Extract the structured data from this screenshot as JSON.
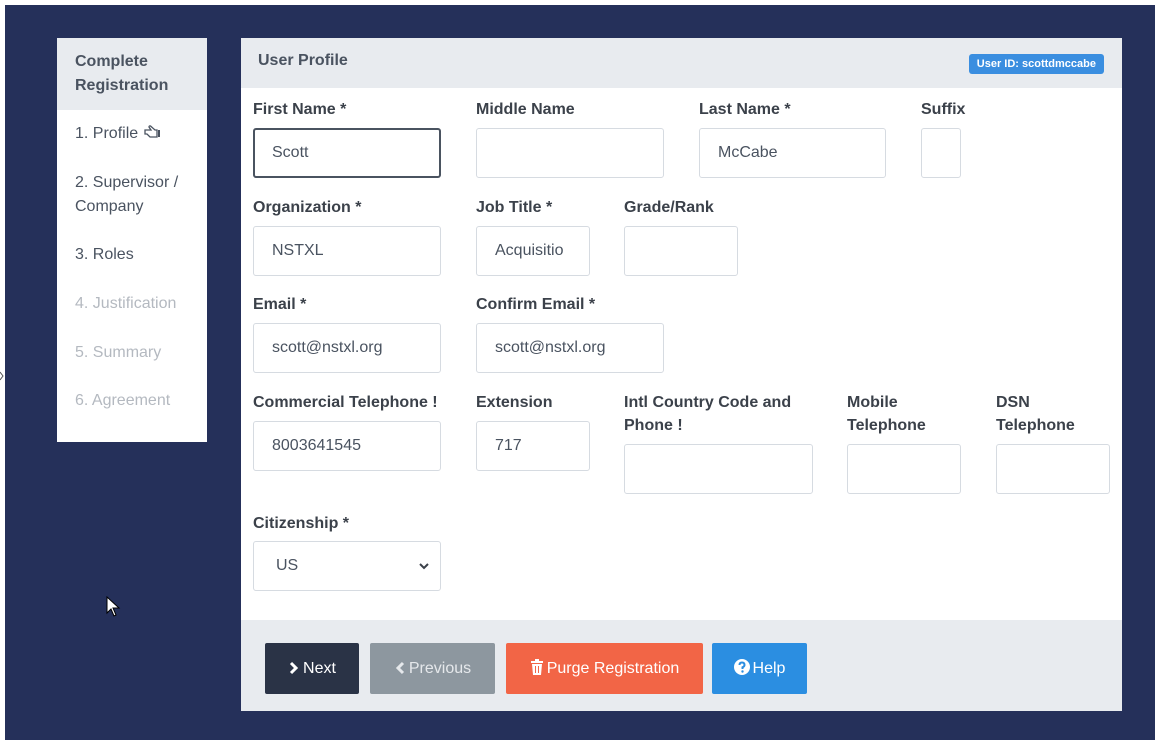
{
  "sidebar": {
    "title": "Complete Registration",
    "steps": [
      {
        "label": "1. Profile",
        "state": "active"
      },
      {
        "label": "2. Supervisor / Company",
        "state": "enabled"
      },
      {
        "label": "3. Roles",
        "state": "enabled"
      },
      {
        "label": "4. Justification",
        "state": "disabled"
      },
      {
        "label": "5. Summary",
        "state": "disabled"
      },
      {
        "label": "6. Agreement",
        "state": "disabled"
      }
    ]
  },
  "panel": {
    "title": "User Profile",
    "user_badge": "User ID: scottdmccabe"
  },
  "fields": {
    "first_name": {
      "label": "First Name *",
      "value": "Scott"
    },
    "middle_name": {
      "label": "Middle Name",
      "value": ""
    },
    "last_name": {
      "label": "Last Name *",
      "value": "McCabe"
    },
    "suffix": {
      "label": "Suffix",
      "value": ""
    },
    "organization": {
      "label": "Organization *",
      "value": "NSTXL"
    },
    "job_title": {
      "label": "Job Title *",
      "value": "Acquisitio"
    },
    "grade_rank": {
      "label": "Grade/Rank",
      "value": ""
    },
    "email": {
      "label": "Email *",
      "value": "scott@nstxl.org"
    },
    "confirm_email": {
      "label": "Confirm Email *",
      "value": "scott@nstxl.org"
    },
    "commercial_telephone": {
      "label": "Commercial Telephone !",
      "value": "8003641545"
    },
    "extension": {
      "label": "Extension",
      "value": "717"
    },
    "intl_phone": {
      "label": "Intl Country Code and Phone !",
      "value": ""
    },
    "mobile_telephone": {
      "label": "Mobile Telephone",
      "value": ""
    },
    "dsn_telephone": {
      "label": "DSN Telephone",
      "value": ""
    },
    "citizenship": {
      "label": "Citizenship *",
      "selected": "US"
    }
  },
  "footer": {
    "next_label": "Next",
    "previous_label": "Previous",
    "purge_label": "Purge Registration",
    "help_label": "Help"
  },
  "colors": {
    "backdrop": "#25305a",
    "next": "#2a3346",
    "previous": "#8d979f",
    "purge": "#f26546",
    "help": "#2b8ee1",
    "badge": "#3a8ee0"
  },
  "icons": {
    "profile_step": "pointing-hand-icon",
    "next": "chevron-right-icon",
    "previous": "chevron-left-icon",
    "purge": "trash-icon",
    "help": "question-circle-icon",
    "select": "chevron-down-icon"
  }
}
